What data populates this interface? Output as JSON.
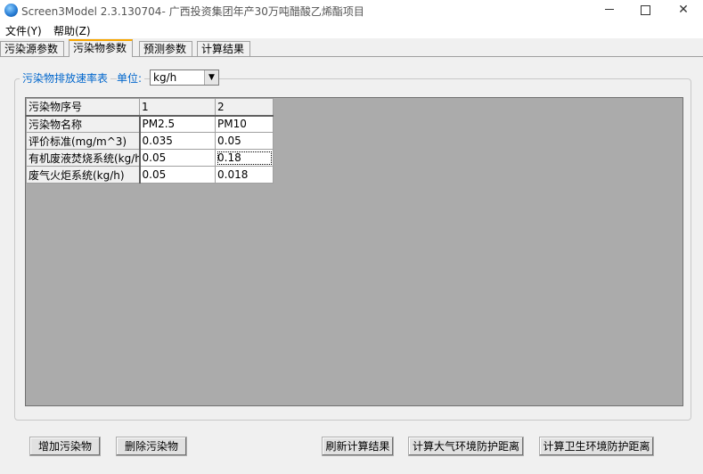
{
  "window": {
    "title": "Screen3Model 2.3.130704- 广西投资集团年产30万吨醋酸乙烯酯项目",
    "minimize_icon": "minimize-icon",
    "maximize_icon": "maximize-icon",
    "close_glyph": "✕"
  },
  "menu": {
    "file": "文件(Y)",
    "help": "帮助(Z)"
  },
  "tabs": [
    {
      "label": "污染源参数"
    },
    {
      "label": "污染物参数"
    },
    {
      "label": "预测参数"
    },
    {
      "label": "计算结果"
    }
  ],
  "group": {
    "legend": "污染物排放速率表",
    "unit_label": "单位:",
    "unit_value": "kg/h"
  },
  "grid": {
    "rows": [
      {
        "header": "污染物序号",
        "c1": "1",
        "c2": "2"
      },
      {
        "header": "污染物名称",
        "c1": "PM2.5",
        "c2": "PM10"
      },
      {
        "header": "评价标准(mg/m^3)",
        "c1": "0.035",
        "c2": "0.05"
      },
      {
        "header": "有机废液焚烧系统(kg/h)",
        "c1": "0.05",
        "c2": "0.18"
      },
      {
        "header": "废气火炬系统(kg/h)",
        "c1": "0.05",
        "c2": "0.018"
      }
    ]
  },
  "buttons": {
    "add": "增加污染物",
    "delete": "删除污染物",
    "refresh": "刷新计算结果",
    "atm": "计算大气环境防护距离",
    "hygiene": "计算卫生环境防护距离"
  },
  "colors": {
    "accent_tab": "#f7a600",
    "legend_text": "#0066cc"
  }
}
